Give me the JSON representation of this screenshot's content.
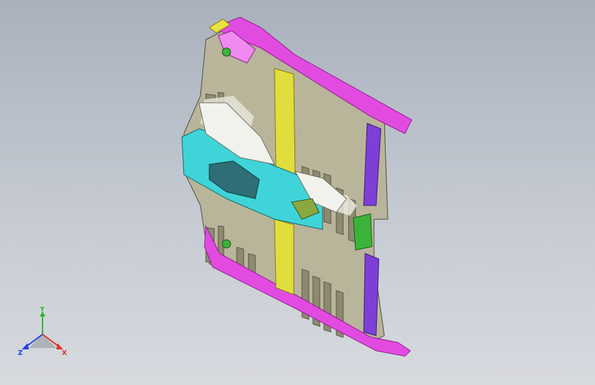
{
  "viewport": {
    "background_top": "#a9b1bd",
    "background_bottom": "#d7dadf"
  },
  "model": {
    "colors": {
      "floor_panel": "#b9b59a",
      "floor_shadow": "#6f6c5a",
      "side_rail": "#e24be0",
      "cross_member": "#e0de3c",
      "tunnel": "#3fd4d8",
      "rear_bracket": "#7d3fd6",
      "mount_bracket": "#3bb33b",
      "top_tab": "#e8e23a",
      "highlight": "#f2f2ec"
    }
  },
  "triad": {
    "x_label": "X",
    "y_label": "Y",
    "z_label": "Z",
    "x_color": "#e03030",
    "y_color": "#30b030",
    "z_color": "#2040e0"
  }
}
